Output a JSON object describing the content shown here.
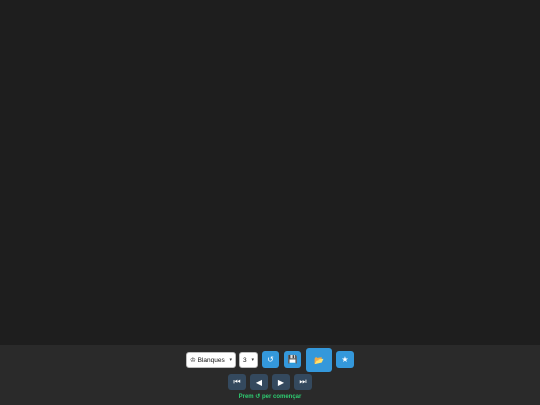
{
  "board_area": {},
  "toolbar": {
    "color_select_value": "♔ Blanques",
    "level_select_value": "3",
    "restart_icon": "↺",
    "save_icon": "💾",
    "open_icon": "📂",
    "star_icon": "★",
    "accent_color": "#3498db"
  },
  "navigation": {
    "first_icon": "⏮",
    "prev_icon": "◀",
    "next_icon": "▶",
    "last_icon": "⏭",
    "button_color": "#34495e"
  },
  "status": {
    "text": "Prem ↺ per començar",
    "color": "#2ecc71"
  }
}
